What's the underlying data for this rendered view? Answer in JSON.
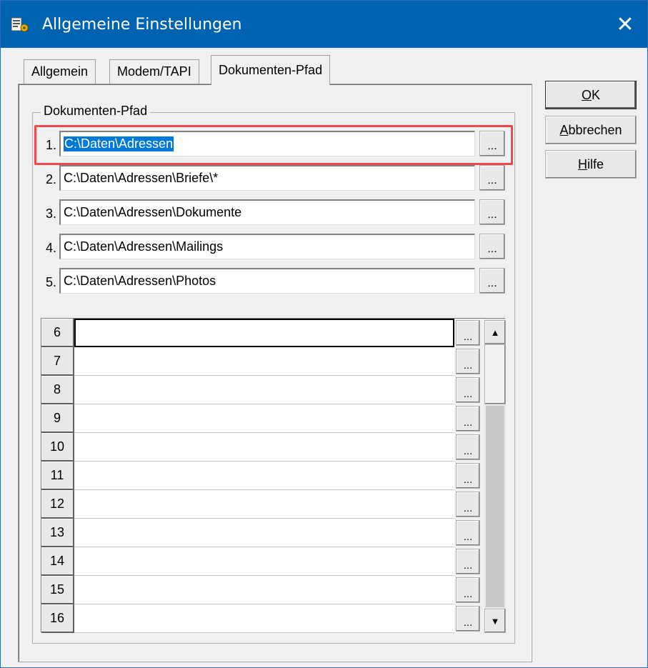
{
  "window": {
    "title": "Allgemeine Einstellungen",
    "app_icon": "address-book-icon",
    "close_glyph": "✕"
  },
  "tabs": [
    {
      "label": "Allgemein",
      "active": false
    },
    {
      "label": "Modem/TAPI",
      "active": false
    },
    {
      "label": "Dokumenten-Pfad",
      "active": true
    }
  ],
  "group": {
    "label": "Dokumenten-Pfad"
  },
  "paths": [
    {
      "num": "1.",
      "value": "C:\\Daten\\Adressen",
      "selected": true
    },
    {
      "num": "2.",
      "value": "C:\\Daten\\Adressen\\Briefe\\*"
    },
    {
      "num": "3.",
      "value": "C:\\Daten\\Adressen\\Dokumente"
    },
    {
      "num": "4.",
      "value": "C:\\Daten\\Adressen\\Mailings"
    },
    {
      "num": "5.",
      "value": "C:\\Daten\\Adressen\\Photos"
    }
  ],
  "browse_label": "...",
  "grid_rows": [
    "6",
    "7",
    "8",
    "9",
    "10",
    "11",
    "12",
    "13",
    "14",
    "15",
    "16"
  ],
  "scroll": {
    "up": "▲",
    "down": "▼"
  },
  "buttons": {
    "ok": {
      "mnemonic": "O",
      "rest": "K"
    },
    "cancel": {
      "mnemonic": "A",
      "rest": "bbrechen"
    },
    "help": {
      "mnemonic": "H",
      "rest": "ilfe"
    }
  },
  "colors": {
    "titlebar": "#0063b1",
    "selection": "#0078d7",
    "highlight_box": "#f0474a"
  }
}
